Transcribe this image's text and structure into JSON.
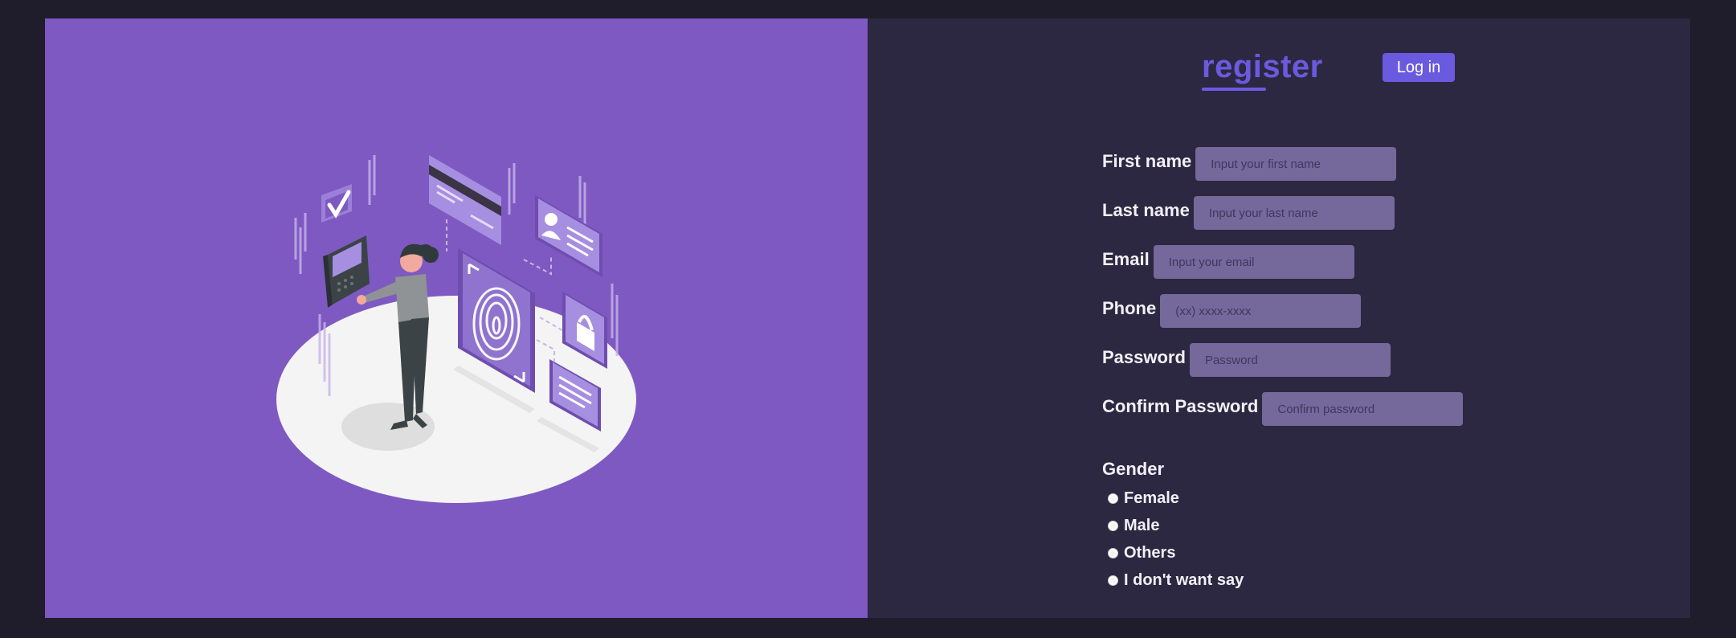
{
  "header": {
    "title": "register",
    "login_label": "Log in"
  },
  "form": {
    "fields": [
      {
        "label": "First name",
        "placeholder": "Input your first name"
      },
      {
        "label": "Last name",
        "placeholder": "Input your last name"
      },
      {
        "label": "Email",
        "placeholder": "Input your email"
      },
      {
        "label": "Phone",
        "placeholder": "(xx) xxxx-xxxx"
      },
      {
        "label": "Password",
        "placeholder": "Password"
      },
      {
        "label": "Confirm Password",
        "placeholder": "Confirm password"
      }
    ],
    "gender": {
      "title": "Gender",
      "options": [
        "Female",
        "Male",
        "Others",
        "I don't want say"
      ]
    }
  },
  "colors": {
    "background": "#1f1d2b",
    "illustration_bg": "#7e59c2",
    "form_bg": "#2d2841",
    "accent": "#6a5ae0",
    "input_bg": "#75689a"
  },
  "icons": [
    "checkmark-icon",
    "fingerprint-icon",
    "lock-icon",
    "id-card-icon",
    "card-reader-icon"
  ]
}
